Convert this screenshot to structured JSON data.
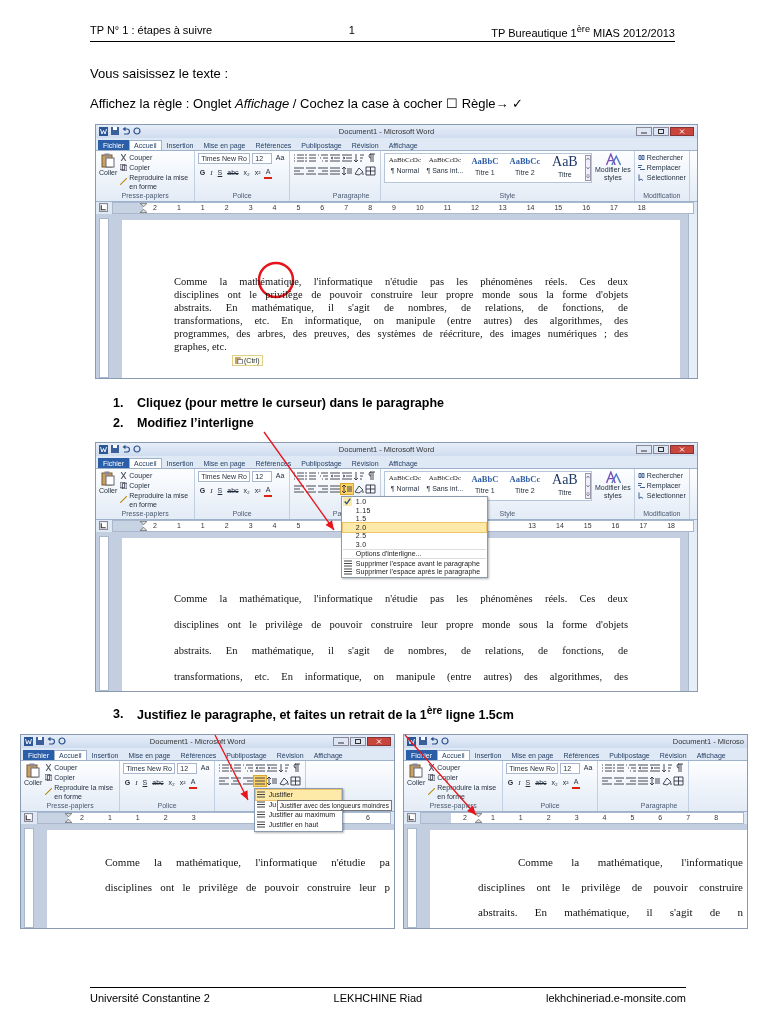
{
  "header": {
    "left": "TP N° 1 : étapes à suivre",
    "center": "1",
    "right": "TP Bureautique 1$^{ère}$ MIAS 2012/2013"
  },
  "intro": "Vous saisissez le texte :",
  "instruction": "Affichez la règle : Onglet *Affichage* / Cochez la case à cocher ☐ Règle→ ✓",
  "windows": [
    {
      "title": "Document1 - Microsoft Word",
      "cursor_circled": true,
      "paste_tag": "(Ctrl)",
      "tabs": [
        {
          "label": "Fichier",
          "kind": "file",
          "selected": false
        },
        {
          "label": "Accueil",
          "kind": "tab",
          "selected": true
        },
        {
          "label": "Insertion",
          "kind": "tab",
          "selected": false
        },
        {
          "label": "Mise en page",
          "kind": "tab",
          "selected": false
        },
        {
          "label": "Références",
          "kind": "tab",
          "selected": false
        },
        {
          "label": "Publipostage",
          "kind": "tab",
          "selected": false
        },
        {
          "label": "Révision",
          "kind": "tab",
          "selected": false
        },
        {
          "label": "Affichage",
          "kind": "tab",
          "selected": false
        }
      ],
      "groups": [
        {
          "kind": "clipboard",
          "label": "Presse-papiers",
          "items": [
            "Coller",
            "Couper",
            "Copier",
            "Reproduire la mise en forme"
          ]
        },
        {
          "kind": "font",
          "label": "Police",
          "font": "Times New Ro",
          "points": "12",
          "buttons": [
            "G",
            "I",
            "S",
            "abc",
            "x₂",
            "x²",
            "Aa",
            "A"
          ]
        },
        {
          "kind": "paragraph",
          "label": "Paragraphe"
        },
        {
          "kind": "styles",
          "label": "Style",
          "styles": [
            {
              "sample": "AaBbCcDc",
              "name": "¶ Normal"
            },
            {
              "sample": "AaBbCcDc",
              "name": "¶ Sans int..."
            },
            {
              "sample": "AaBbC",
              "name": "Titre 1"
            },
            {
              "sample": "AaBbCc",
              "name": "Titre 2"
            },
            {
              "sample": "AaB",
              "name": "Titre"
            }
          ],
          "more": "Modifier les styles"
        },
        {
          "kind": "editing",
          "label": "Modification",
          "items": [
            "Rechercher",
            "Remplacer",
            "Sélectionner"
          ]
        }
      ],
      "ruler": [
        [
          "2",
          "1",
          "1",
          "2",
          "3",
          "4",
          "5",
          "6",
          "7",
          "8",
          "9",
          "10",
          "11",
          "12",
          "13",
          "14",
          "15",
          "16",
          "17",
          "18"
        ]
      ],
      "document": {
        "double_spacing": false,
        "indent_first": false,
        "ends": true,
        "lines": [
          "Comme la mathématique, l'informatique n'étudie pas les phénomènes réels. Ces deux",
          "disciplines ont le privilège de pouvoir construire leur propre monde sous la forme d'objets",
          "abstraits. En mathématique, il s'agit de nombres, de relations, de fonctions, de",
          "transformations, etc. En informatique, on manipule (entre autres) des algorithmes, des",
          "programmes, des arbres, des preuves, des systèmes de réécriture, des images numériques ; des",
          "graphes, etc."
        ]
      }
    },
    {
      "title": "Document1 - Microsoft Word",
      "tabs": [
        {
          "label": "Fichier",
          "kind": "file",
          "selected": false
        },
        {
          "label": "Accueil",
          "kind": "tab",
          "selected": true
        },
        {
          "label": "Insertion",
          "kind": "tab",
          "selected": false
        },
        {
          "label": "Mise en page",
          "kind": "tab",
          "selected": false
        },
        {
          "label": "Références",
          "kind": "tab",
          "selected": false
        },
        {
          "label": "Publipostage",
          "kind": "tab",
          "selected": false
        },
        {
          "label": "Révision",
          "kind": "tab",
          "selected": false
        },
        {
          "label": "Affichage",
          "kind": "tab",
          "selected": false
        }
      ],
      "groups": [
        {
          "kind": "clipboard",
          "label": "Presse-papiers",
          "items": [
            "Coller",
            "Couper",
            "Copier",
            "Reproduire la mise en forme"
          ]
        },
        {
          "kind": "font",
          "label": "Police",
          "font": "Times New Ro",
          "points": "12",
          "buttons": [
            "G",
            "I",
            "S",
            "abc",
            "x₂",
            "x²",
            "Aa",
            "A"
          ]
        },
        {
          "kind": "paragraph",
          "label": "Pa"
        },
        {
          "kind": "styles",
          "label": "Style",
          "styles": [
            {
              "sample": "AaBbCcDc",
              "name": "¶ Normal"
            },
            {
              "sample": "AaBbCcDc",
              "name": "¶ Sans int..."
            },
            {
              "sample": "AaBbC",
              "name": "Titre 1"
            },
            {
              "sample": "AaBbCc",
              "name": "Titre 2"
            },
            {
              "sample": "AaB",
              "name": "Titre"
            }
          ],
          "more": "Modifier les styles"
        },
        {
          "kind": "editing",
          "label": "Modification",
          "items": [
            "Rechercher",
            "Remplacer",
            "Sélectionner"
          ]
        }
      ],
      "ruler": [
        [
          "2",
          "1",
          "1",
          "2",
          "3",
          "4",
          "5"
        ],
        [
          "13",
          "14",
          "15",
          "16",
          "17",
          "18"
        ]
      ],
      "menu": {
        "kind": "line_spacing",
        "items": [
          {
            "label": "1.0",
            "kind": "value",
            "checked": true,
            "selected": false
          },
          {
            "label": "1.15",
            "kind": "value",
            "checked": false,
            "selected": false
          },
          {
            "label": "1.5",
            "kind": "value",
            "checked": false,
            "selected": false
          },
          {
            "label": "2.0",
            "kind": "value",
            "checked": false,
            "selected": true
          },
          {
            "label": "2.5",
            "kind": "value",
            "checked": false,
            "selected": false
          },
          {
            "label": "3.0",
            "kind": "value",
            "checked": false,
            "selected": false
          },
          {
            "label": "Options d'interligne...",
            "kind": "option",
            "checked": false,
            "selected": false
          },
          {
            "label": "Supprimer l'espace avant le paragraphe",
            "kind": "action",
            "checked": false,
            "selected": false
          },
          {
            "label": "Supprimer l'espace après le paragraphe",
            "kind": "action",
            "checked": false,
            "selected": false
          }
        ]
      },
      "document": {
        "double_spacing": true,
        "indent_first": false,
        "ends": false,
        "lines": [
          "Comme la mathématique, l'informatique n'étudie pas les phénomènes réels. Ces deux",
          "disciplines ont le privilège de pouvoir construire leur propre monde sous la forme d'objets",
          "abstraits. En mathématique, il s'agit de nombres, de relations, de fonctions, de",
          "transformations, etc. En informatique, on manipule (entre autres) des algorithmes, des"
        ]
      }
    },
    {
      "title": "Document1 - Microsoft Word",
      "tabs": [
        {
          "label": "Fichier",
          "kind": "file",
          "selected": false
        },
        {
          "label": "Accueil",
          "kind": "tab",
          "selected": true
        },
        {
          "label": "Insertion",
          "kind": "tab",
          "selected": false
        },
        {
          "label": "Mise en page",
          "kind": "tab",
          "selected": false
        },
        {
          "label": "Références",
          "kind": "tab",
          "selected": false
        },
        {
          "label": "Publipostage",
          "kind": "tab",
          "selected": false
        },
        {
          "label": "Révision",
          "kind": "tab",
          "selected": false
        },
        {
          "label": "Affichage",
          "kind": "tab",
          "selected": false
        }
      ],
      "groups": [
        {
          "kind": "clipboard",
          "label": "Presse-papiers",
          "items": [
            "Coller",
            "Couper",
            "Copier",
            "Reproduire la mise en forme"
          ]
        },
        {
          "kind": "font",
          "label": "Police",
          "font": "Times New Ro",
          "points": "12",
          "buttons": [
            "G",
            "I",
            "S",
            "abc",
            "x₂",
            "x²",
            "Aa",
            "A"
          ]
        },
        {
          "kind": "paragraph"
        }
      ],
      "ruler": [
        [
          "2",
          "1",
          "1",
          "2",
          "3"
        ],
        [
          "6"
        ]
      ],
      "menu": {
        "kind": "alignment",
        "tooltip": "Justifier avec des longueurs moindres",
        "items": [
          {
            "label": "Justifier",
            "kind": "action",
            "selected": true
          },
          {
            "label": "Ju",
            "kind": "action",
            "selected": false
          },
          {
            "label": "Justifier au maximum",
            "kind": "action",
            "selected": false
          },
          {
            "label": "Justifier en haut",
            "kind": "action",
            "selected": false
          }
        ]
      },
      "document": {
        "double_spacing": true,
        "indent_first": false,
        "ends": false,
        "lines": [
          "Comme la mathématique, l'informatique n'étudie pa",
          "disciplines ont le privilège de pouvoir construire leur p"
        ]
      }
    },
    {
      "title": "Document1 - Microso",
      "tabs": [
        {
          "label": "Fichier",
          "kind": "file",
          "selected": false
        },
        {
          "label": "Accueil",
          "kind": "tab",
          "selected": true
        },
        {
          "label": "Insertion",
          "kind": "tab",
          "selected": false
        },
        {
          "label": "Mise en page",
          "kind": "tab",
          "selected": false
        },
        {
          "label": "Références",
          "kind": "tab",
          "selected": false
        },
        {
          "label": "Publipostage",
          "kind": "tab",
          "selected": false
        },
        {
          "label": "Révision",
          "kind": "tab",
          "selected": false
        },
        {
          "label": "Affichage",
          "kind": "tab",
          "selected": false
        }
      ],
      "groups": [
        {
          "kind": "clipboard",
          "label": "Presse-papiers",
          "items": [
            "Coller",
            "Couper",
            "Copier",
            "Reproduire la mise en forme"
          ]
        },
        {
          "kind": "font",
          "label": "Police",
          "font": "Times New Ro",
          "points": "12",
          "buttons": [
            "G",
            "I",
            "S",
            "abc",
            "x₂",
            "x²",
            "Aa",
            "A"
          ]
        },
        {
          "kind": "paragraph",
          "label": "Paragraphe"
        }
      ],
      "ruler": [
        [
          "2",
          "1",
          "1",
          "2",
          "3",
          "4",
          "5",
          "6",
          "7",
          "8"
        ]
      ],
      "document": {
        "double_spacing": true,
        "indent_first": true,
        "ends": false,
        "lines": [
          "Comme la mathématique, l'informatique",
          "disciplines ont le privilège de pouvoir construire",
          "abstraits. En mathématique, il s'agit de n"
        ]
      }
    }
  ],
  "steps_a": [
    {
      "number": "1.",
      "text": "Cliquez (pour mettre le curseur) dans le paragraphe"
    },
    {
      "number": "2.",
      "text": "Modifiez l’interligne"
    }
  ],
  "step_b": {
    "number": "3.",
    "text": "Justifiez le paragraphe, et faites un retrait de la 1$^{ère}$ ligne 1.5cm"
  },
  "footer": {
    "left": "Université Constantine 2",
    "center": "LEKHCHINE Riad",
    "right": "lekhchineriad.e-monsite.com"
  }
}
